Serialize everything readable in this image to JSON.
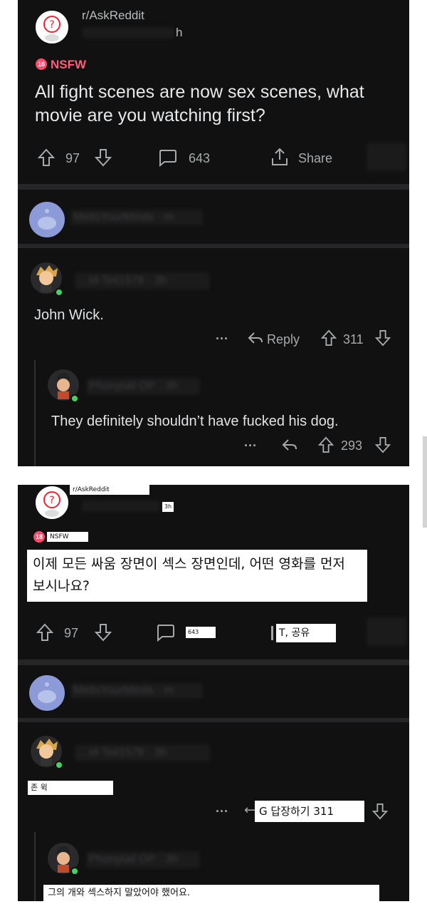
{
  "post": {
    "subreddit": "r/AskReddit",
    "post_age_suffix": "h",
    "nsfw_badge": "18",
    "nsfw_label": "NSFW",
    "title": "All fight scenes are now sex scenes, what movie are you watching first?",
    "upvotes": "97",
    "comment_count": "643",
    "share_label": "Share"
  },
  "comments": {
    "c0_user": "MeltsYourMinds · m",
    "c1_user": "…id-Teil1578 · 3h",
    "c1_text": "John Wick.",
    "c1_more": "···",
    "c1_reply_label": "Reply",
    "c1_votes": "311",
    "c2_user": "Phonytail OP · 3h",
    "c2_text": "They definitely shouldn’t have fucked his dog.",
    "c2_more": "···",
    "c2_votes": "293"
  },
  "translated": {
    "subreddit": "r/AskReddit",
    "post_age": "3h",
    "nsfw_label": "NSFW",
    "title": "이제 모든 싸움 장면이 섹스 장면인데, 어떤 영화를 먼저 보시나요?",
    "upvotes": "97",
    "comment_count": "643",
    "share_label": "T, 공유",
    "c1_text": "존 윅",
    "reply_votes_label": "G 답장하기 311",
    "c2_text": "그의 개와 섹스하지 말았어야 했어요."
  },
  "colors": {
    "background": "#111112",
    "nsfw": "#ff5c7a",
    "online": "#46d160",
    "page": "#ffffff"
  }
}
